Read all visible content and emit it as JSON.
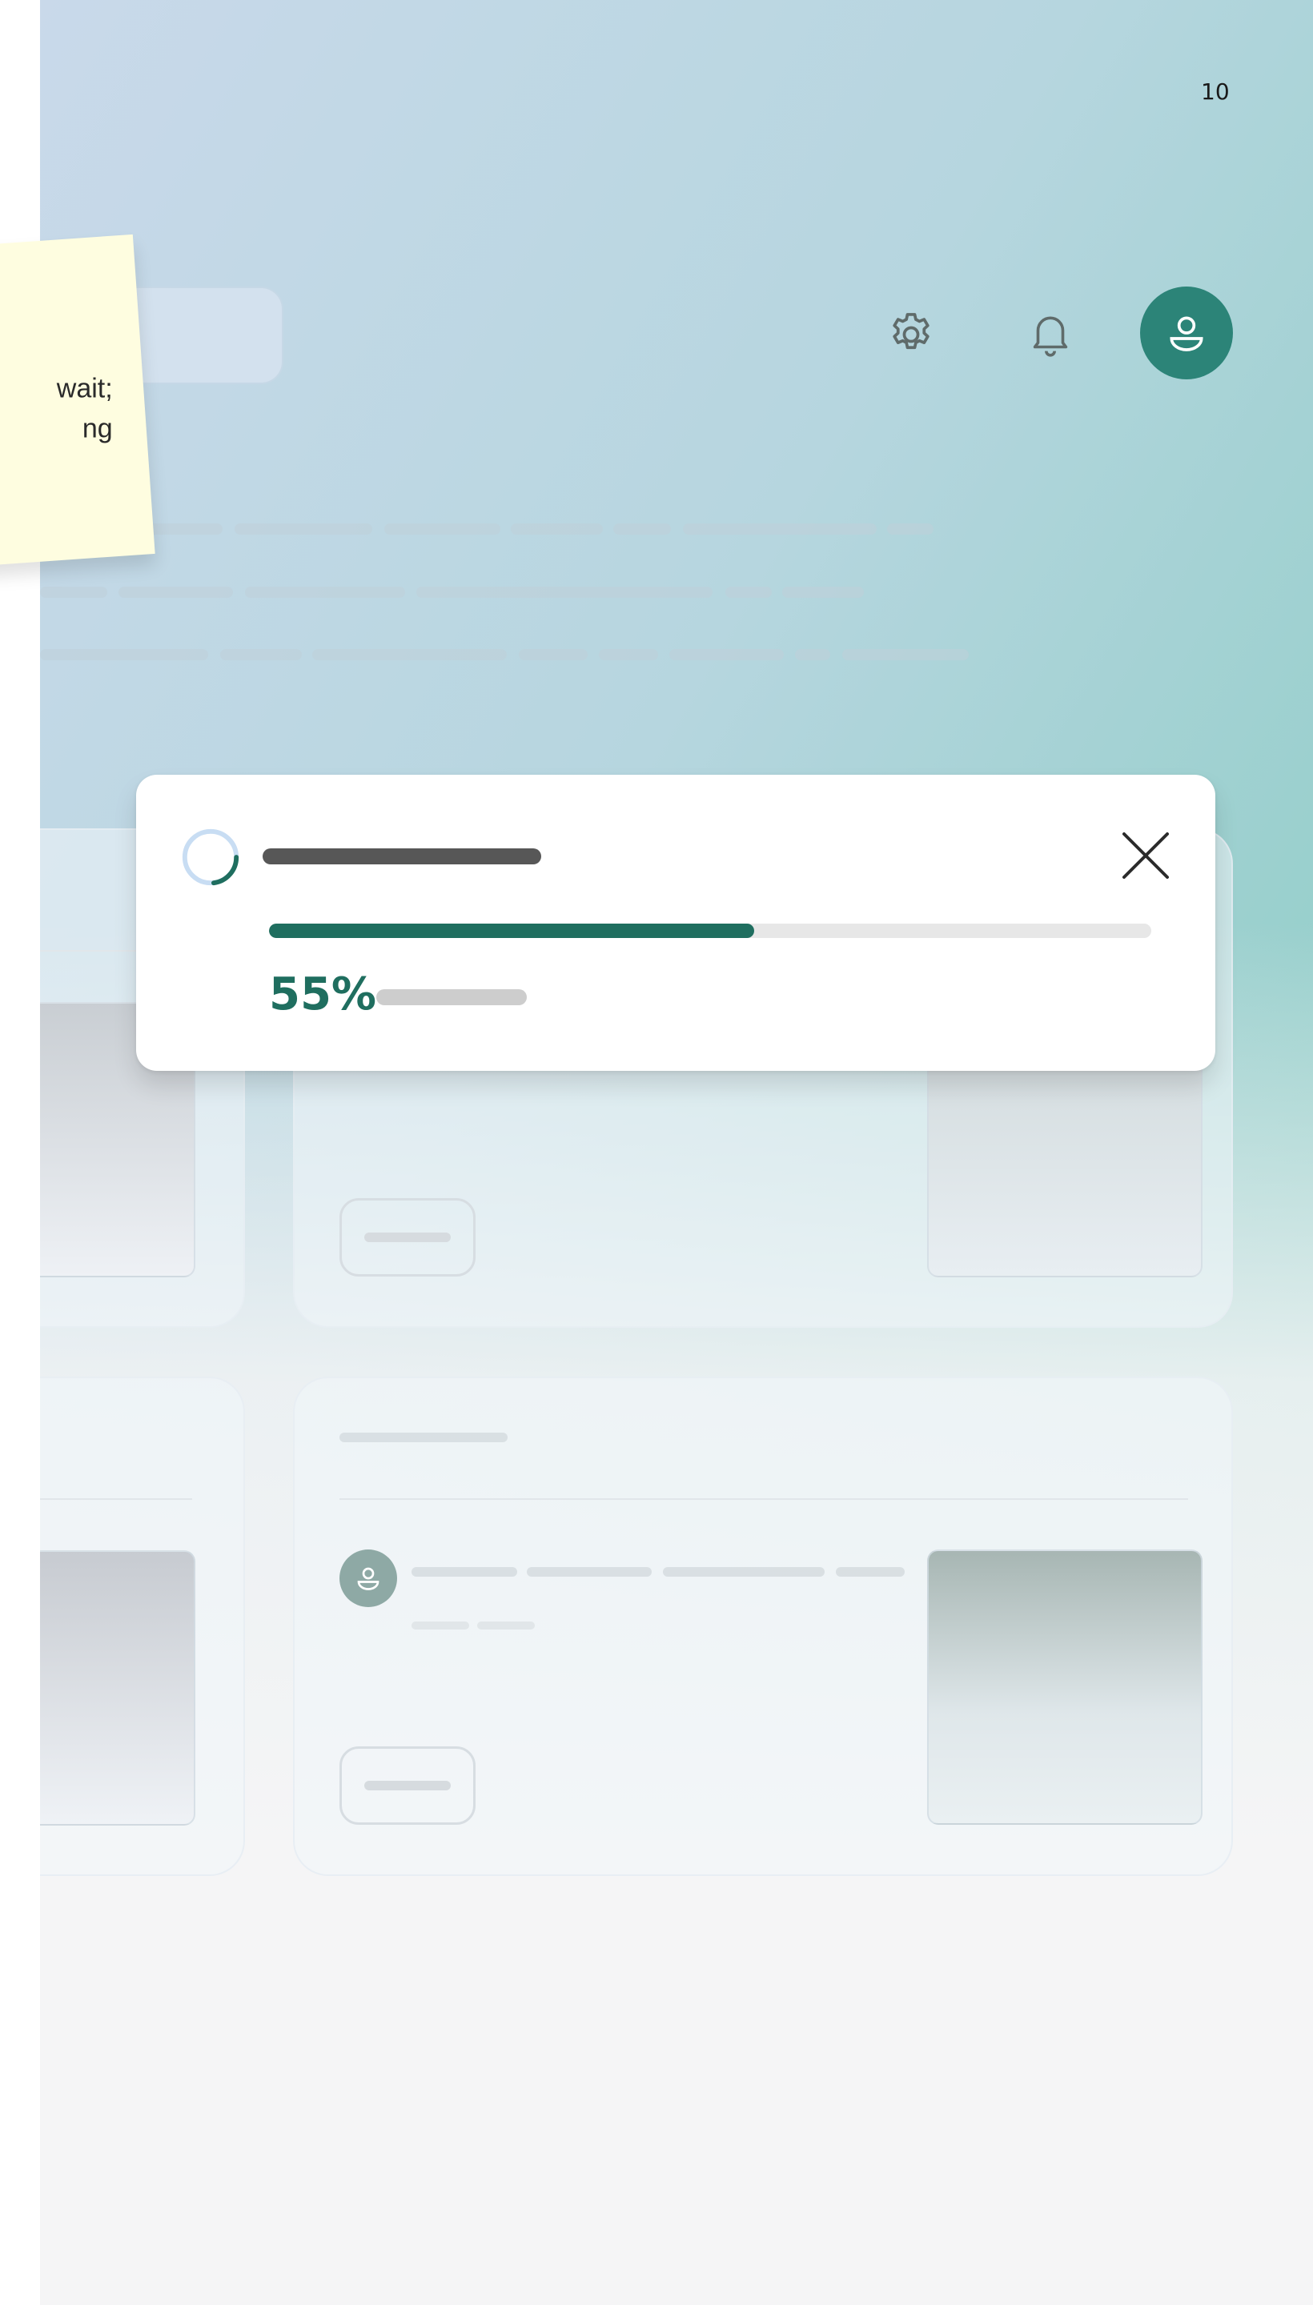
{
  "page": {
    "number": "10"
  },
  "header": {
    "icons": [
      "gear-icon",
      "bell-icon",
      "user-icon"
    ],
    "accent_color": "#2c8478"
  },
  "sticky_note": {
    "text": "wait; ng"
  },
  "progress_dialog": {
    "percent_label": "55%",
    "progress": 0.55,
    "fill_color": "#1f6e5f",
    "close_icon": "close-icon",
    "spinner_icon": "spinner-icon"
  }
}
